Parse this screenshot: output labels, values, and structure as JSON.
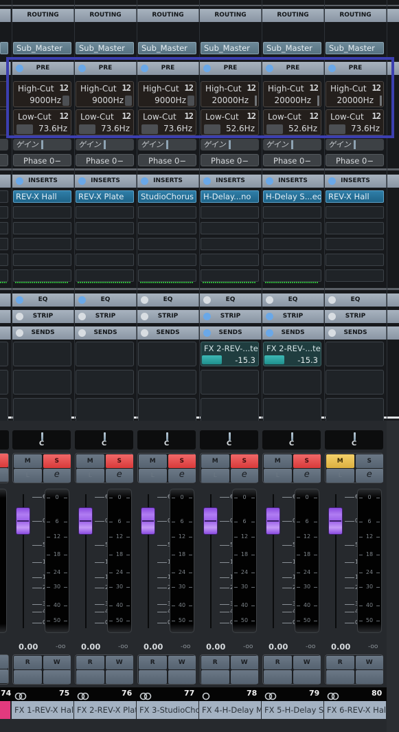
{
  "sections": {
    "routing": "ROUTING",
    "pre": "PRE",
    "inserts": "INSERTS",
    "eq": "EQ",
    "strip": "STRIP",
    "sends": "SENDS"
  },
  "labels": {
    "high_cut": "High-Cut",
    "low_cut": "Low-Cut",
    "slope": "12",
    "gain": "ゲイン",
    "phase": "Phase 0−",
    "pan_center": "C",
    "mute": "M",
    "solo": "S",
    "listen": "L",
    "edit": "e",
    "read": "R",
    "write": "W",
    "volume": "0.00",
    "peak": "-oo"
  },
  "left_partial": {
    "number": "74",
    "color": "#e23a7e"
  },
  "channels": [
    {
      "number": "75",
      "name": "FX 1-REV-X Hal",
      "routing": "Sub_Master",
      "pre_led": true,
      "high_cut": "9000Hz",
      "low_cut": "73.6Hz",
      "insert": "REV-X Hall",
      "insert_meter": true,
      "eq_on": true,
      "strip_on": false,
      "sends_on": false,
      "send": null,
      "mute": false,
      "solo": true,
      "stereo": true
    },
    {
      "number": "76",
      "name": "FX 2-REV-X Plat",
      "routing": "Sub_Master",
      "pre_led": true,
      "high_cut": "9000Hz",
      "low_cut": "73.6Hz",
      "insert": "REV-X Plate",
      "insert_meter": true,
      "eq_on": true,
      "strip_on": false,
      "sends_on": false,
      "send": null,
      "mute": false,
      "solo": true,
      "stereo": true
    },
    {
      "number": "77",
      "name": "FX 3-StudioCho",
      "routing": "Sub_Master",
      "pre_led": true,
      "high_cut": "9000Hz",
      "low_cut": "73.6Hz",
      "insert": "StudioChorus",
      "insert_meter": true,
      "eq_on": false,
      "strip_on": false,
      "sends_on": false,
      "send": null,
      "mute": false,
      "solo": true,
      "stereo": true
    },
    {
      "number": "78",
      "name": "FX 4-H-Delay M",
      "routing": "Sub_Master",
      "pre_led": true,
      "high_cut": "20000Hz",
      "low_cut": "52.6Hz",
      "insert": "H-Delay...no",
      "insert_meter": true,
      "eq_on": false,
      "strip_on": true,
      "sends_on": true,
      "send": {
        "name": "FX 2-REV-...te",
        "value": "-15.3"
      },
      "mute": false,
      "solo": true,
      "stereo": false
    },
    {
      "number": "79",
      "name": "FX 5-H-Delay St",
      "routing": "Sub_Master",
      "pre_led": true,
      "high_cut": "20000Hz",
      "low_cut": "52.6Hz",
      "insert": "H-Delay S...eo",
      "insert_meter": true,
      "eq_on": false,
      "strip_on": true,
      "sends_on": true,
      "send": {
        "name": "FX 2-REV-...te",
        "value": "-15.3"
      },
      "mute": false,
      "solo": true,
      "stereo": true
    },
    {
      "number": "80",
      "name": "FX 6-REV-X Hal",
      "routing": "Sub_Master",
      "pre_led": true,
      "high_cut": "20000Hz",
      "low_cut": "73.6Hz",
      "insert": "REV-X Hall",
      "insert_meter": false,
      "eq_on": false,
      "strip_on": false,
      "sends_on": false,
      "send": null,
      "mute": true,
      "solo": false,
      "stereo": true
    }
  ],
  "fader_scale": [
    "6",
    "0",
    "5",
    "10",
    "15",
    "20",
    "30",
    "40",
    "00"
  ],
  "meter_scale": [
    "0",
    "6",
    "12",
    "18",
    "24",
    "30",
    "40",
    "50"
  ],
  "fader_level_db": 0
}
